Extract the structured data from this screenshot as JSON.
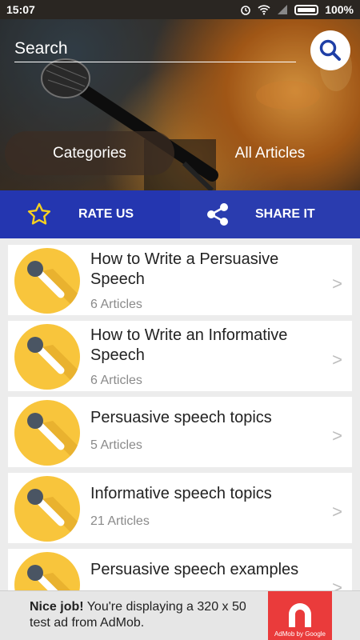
{
  "status": {
    "time": "15:07",
    "battery": "100%"
  },
  "search": {
    "placeholder": "Search"
  },
  "tabs": {
    "categories": "Categories",
    "all_articles": "All Articles"
  },
  "actions": {
    "rate": "RATE US",
    "share": "SHARE IT"
  },
  "list": [
    {
      "title": "How to Write a Persuasive Speech",
      "count": "6 Articles"
    },
    {
      "title": "How to Write an Informative Speech",
      "count": "6 Articles"
    },
    {
      "title": "Persuasive speech topics",
      "count": "5 Articles"
    },
    {
      "title": "Informative speech topics",
      "count": "21 Articles"
    },
    {
      "title": "Persuasive speech examples",
      "count": ""
    }
  ],
  "ad": {
    "headline": "Nice job!",
    "body": "You're displaying a 320 x 50 test ad from AdMob.",
    "logo_label": "AdMob by Google"
  },
  "colors": {
    "action_bar": "#2436b0",
    "avatar": "#f8c53c",
    "ad_logo": "#ea3b3b"
  }
}
